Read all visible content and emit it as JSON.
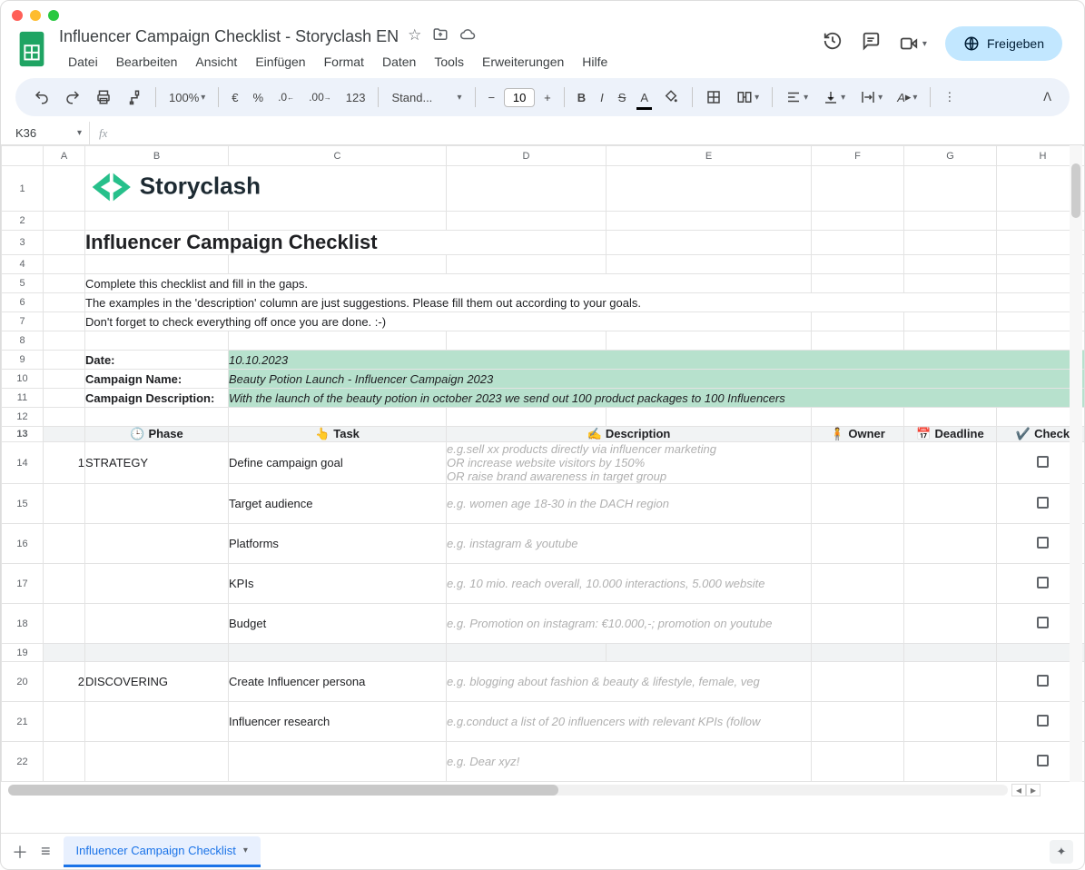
{
  "doc": {
    "title": "Influencer Campaign Checklist - Storyclash EN"
  },
  "menus": [
    "Datei",
    "Bearbeiten",
    "Ansicht",
    "Einfügen",
    "Format",
    "Daten",
    "Tools",
    "Erweiterungen",
    "Hilfe"
  ],
  "share_label": "Freigeben",
  "toolbar": {
    "zoom": "100%",
    "font": "Stand...",
    "size": "10"
  },
  "namebox": "K36",
  "columns": [
    "",
    "A",
    "B",
    "C",
    "D",
    "E",
    "F",
    "G",
    "H",
    ""
  ],
  "sheet": {
    "logo_text": "Storyclash",
    "title": "Influencer Campaign Checklist",
    "intro": [
      "Complete this checklist and fill in the gaps.",
      "The examples in the 'description' column are just suggestions. Please fill them out according to your goals.",
      "Don't forget to check everything off once you are done. :-)"
    ],
    "meta": {
      "date_label": "Date:",
      "date_value": "10.10.2023",
      "name_label": "Campaign Name:",
      "name_value": "Beauty Potion Launch - Influencer Campaign 2023",
      "desc_label": "Campaign Description:",
      "desc_value": "With the launch of the beauty potion in october 2023 we send out 100 product packages to 100 Influencers"
    },
    "headers": {
      "phase": "Phase",
      "task": "Task",
      "description": "Description",
      "owner": "Owner",
      "deadline": "Deadline",
      "check": "Check"
    },
    "rows": [
      {
        "num": "1",
        "phase": "STRATEGY",
        "task": "Define campaign goal",
        "desc": "e.g.sell xx products directly via influencer marketing\nOR increase website visitors by 150%\nOR raise brand awareness in target group"
      },
      {
        "num": "",
        "phase": "",
        "task": "Target audience",
        "desc": "e.g. women age 18-30 in the DACH region"
      },
      {
        "num": "",
        "phase": "",
        "task": "Platforms",
        "desc": "e.g. instagram & youtube"
      },
      {
        "num": "",
        "phase": "",
        "task": "KPIs",
        "desc": "e.g. 10 mio. reach overall, 10.000 interactions, 5.000 website"
      },
      {
        "num": "",
        "phase": "",
        "task": "Budget",
        "desc": "e.g. Promotion on instagram: €10.000,-; promotion on youtube"
      },
      {
        "gap": true
      },
      {
        "num": "2",
        "phase": "DISCOVERING",
        "task": "Create Influencer persona",
        "desc": "e.g. blogging about fashion & beauty & lifestyle, female, veg"
      },
      {
        "num": "",
        "phase": "",
        "task": "Influencer research",
        "desc": "e.g.conduct a list of 20 influencers with relevant KPIs (follow"
      },
      {
        "num": "",
        "phase": "",
        "task": "",
        "desc": "e.g. Dear xyz!"
      }
    ]
  },
  "sheet_tab": "Influencer Campaign Checklist"
}
